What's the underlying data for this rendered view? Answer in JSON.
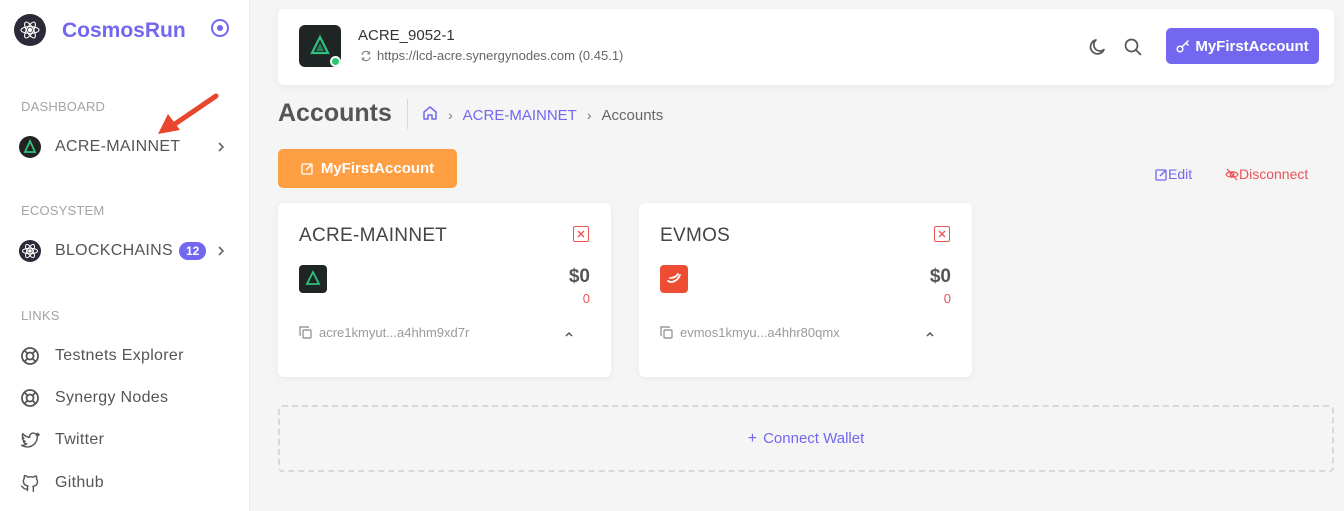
{
  "brand": {
    "name": "CosmosRun"
  },
  "sidebar": {
    "sections": [
      {
        "header": "DASHBOARD"
      },
      {
        "header": "ECOSYSTEM"
      },
      {
        "header": "LINKS"
      }
    ],
    "dashboard_items": [
      {
        "label": "ACRE-MAINNET"
      }
    ],
    "ecosystem_items": [
      {
        "label": "BLOCKCHAINS",
        "badge": "12"
      }
    ],
    "links": [
      {
        "label": "Testnets Explorer",
        "icon": "lifebuoy-icon"
      },
      {
        "label": "Synergy Nodes",
        "icon": "lifebuoy-icon"
      },
      {
        "label": "Twitter",
        "icon": "twitter-icon"
      },
      {
        "label": "Github",
        "icon": "github-icon"
      }
    ]
  },
  "topbar": {
    "chain_id": "ACRE_9052-1",
    "endpoint": "https://lcd-acre.synergynodes.com (0.45.1)",
    "account_button": "MyFirstAccount"
  },
  "breadcrumb": {
    "title": "Accounts",
    "link": "ACRE-MAINNET",
    "current": "Accounts"
  },
  "actions": {
    "profile_button": "MyFirstAccount",
    "edit": "Edit",
    "disconnect": "Disconnect"
  },
  "cards": [
    {
      "title": "ACRE-MAINNET",
      "balance": "$0",
      "amount": "0",
      "address": "acre1kmyut...a4hhm9xd7r"
    },
    {
      "title": "EVMOS",
      "balance": "$0",
      "amount": "0",
      "address": "evmos1kmyu...a4hhr80qmx"
    }
  ],
  "connect_wallet": "Connect Wallet",
  "colors": {
    "primary": "#7367f0",
    "warning": "#ff9f43",
    "danger": "#ea5455",
    "success": "#28c76f",
    "annotation_arrow": "#e8462f"
  }
}
